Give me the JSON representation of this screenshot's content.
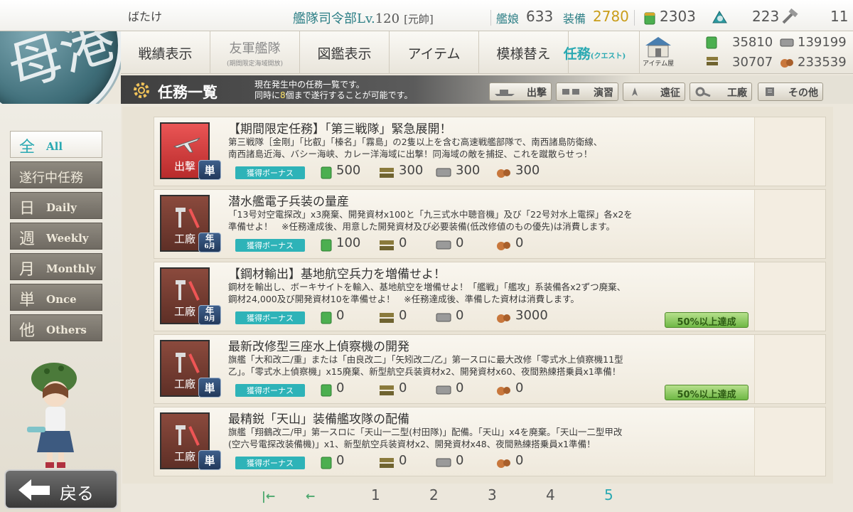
{
  "player": {
    "name": "ばたけ"
  },
  "hq": {
    "label": "艦隊司令部Lv.",
    "level": "120",
    "rank": "[元帥]"
  },
  "stats": {
    "ships_label": "艦娘",
    "ships_value": "633",
    "equip_label": "装備",
    "equip_value": "2780",
    "fuel_value": "2303",
    "instant_repair_value": "223",
    "dev_material_value": "11"
  },
  "nav": {
    "items": [
      {
        "label": "戦績表示"
      },
      {
        "label": "友軍艦隊",
        "sub": "(期間限定海域開放)"
      },
      {
        "label": "図鑑表示"
      },
      {
        "label": "アイテム"
      },
      {
        "label": "模様替え"
      },
      {
        "label": "任務",
        "small": "(クエスト)"
      }
    ],
    "shop_label": "アイテム屋"
  },
  "resources": {
    "fuel": "35810",
    "steel": "139199",
    "ammo": "30707",
    "bauxite": "233539"
  },
  "title": {
    "text": "任務一覧",
    "desc_line1": "現在発生中の任務一覧です。",
    "desc_line2_a": "同時に",
    "desc_line2_num": "8",
    "desc_line2_b": "個まで遂行することが可能です。"
  },
  "category_tabs": [
    "出撃",
    "演習",
    "遠征",
    "工廠",
    "その他"
  ],
  "left_tabs": [
    {
      "kanji": "全",
      "en": "All",
      "active": true
    },
    {
      "kanji": "遂行中任務",
      "en": ""
    },
    {
      "kanji": "日",
      "en": "Daily"
    },
    {
      "kanji": "週",
      "en": "Weekly"
    },
    {
      "kanji": "月",
      "en": "Monthly"
    },
    {
      "kanji": "単",
      "en": "Once"
    },
    {
      "kanji": "他",
      "en": "Others"
    }
  ],
  "back_label": "戻る",
  "bonus_label": "獲得ボーナス",
  "quests": [
    {
      "category": "出撃",
      "freq": "単",
      "title": "【期間限定任務】「第三戦隊」緊急展開！",
      "desc1": "第三戦隊［金剛」「比叡」「榛名」「霧島」の2隻以上を含む高速戦艦部隊で、南西諸島防衛線、",
      "desc2": "南西諸島近海、バシー海峡、カレー洋海域に出撃！同海域の敵を捕捉、これを蹴散らせっ！",
      "fuel": "500",
      "ammo": "300",
      "steel": "300",
      "bauxite": "300",
      "progress": ""
    },
    {
      "category": "工廠",
      "freq": "年",
      "freq_month": "6月",
      "title": "潜水艦電子兵装の量産",
      "desc1": "「13号対空電探改」x3廃棄、開発資材x100と「九三式水中聴音機」及び「22号対水上電探」各x2を",
      "desc2": "準備せよ！　※任務達成後、用意した開発資材及び必要装備(低改修値のもの優先)は消費します。",
      "fuel": "100",
      "ammo": "0",
      "steel": "0",
      "bauxite": "0",
      "progress": ""
    },
    {
      "category": "工廠",
      "freq": "年",
      "freq_month": "9月",
      "title": "【鋼材輸出】基地航空兵力を増備せよ！",
      "desc1": "鋼材を輸出し、ボーキサイトを輸入、基地航空を増備せよ！「艦戦」「艦攻」系装備各x2ずつ廃棄、",
      "desc2": "鋼材24,000及び開発資材10を準備せよ！　※任務達成後、準備した資材は消費します。",
      "fuel": "0",
      "ammo": "0",
      "steel": "0",
      "bauxite": "3000",
      "progress": "50%以上達成"
    },
    {
      "category": "工廠",
      "freq": "単",
      "title": "最新改修型三座水上偵察機の開発",
      "desc1": "旗艦「大和改二/重」または「由良改二」「矢矧改二/乙」第一スロに最大改修「零式水上偵察機11型",
      "desc2": "乙」。「零式水上偵察機」x15廃棄、新型航空兵装資材x2、開発資材x60、夜間熟練搭乗員x1準備！",
      "fuel": "0",
      "ammo": "0",
      "steel": "0",
      "bauxite": "0",
      "progress": "50%以上達成"
    },
    {
      "category": "工廠",
      "freq": "単",
      "title": "最精鋭「天山」装備艦攻隊の配備",
      "desc1": "旗艦「翔鶴改二/甲」第一スロに「天山一二型(村田隊)」配備。「天山」x4を廃棄。「天山一二型甲改",
      "desc2": "(空六号電探改装備機)」x1、新型航空兵装資材x2、開発資材x48、夜間熟練搭乗員x1準備！",
      "fuel": "0",
      "ammo": "0",
      "steel": "0",
      "bauxite": "0",
      "progress": ""
    }
  ],
  "pager": {
    "pages": [
      "1",
      "2",
      "3",
      "4",
      "5"
    ],
    "current": "5"
  }
}
